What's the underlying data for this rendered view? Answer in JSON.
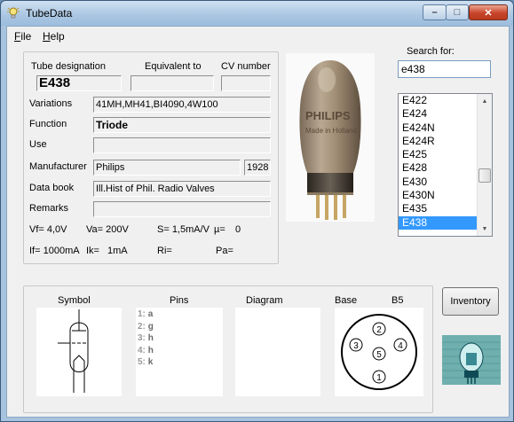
{
  "window": {
    "title": "TubeData",
    "minimize_glyph": "–",
    "maximize_glyph": "□",
    "close_glyph": "✕"
  },
  "menu": {
    "file": "File",
    "help": "Help"
  },
  "header": {
    "designation_label": "Tube designation",
    "equivalent_label": "Equivalent to",
    "cv_label": "CV number",
    "designation_value": "E438",
    "equivalent_value": "",
    "cv_value": ""
  },
  "fields": {
    "variations_label": "Variations",
    "variations_value": "41MH,MH41,BI4090,4W100",
    "function_label": "Function",
    "function_value": "Triode",
    "use_label": "Use",
    "use_value": "",
    "manufacturer_label": "Manufacturer",
    "manufacturer_value": "Philips",
    "year_value": "1928",
    "databook_label": "Data book",
    "databook_value": "Ill.Hist of Phil. Radio Valves",
    "remarks_label": "Remarks",
    "remarks_value": ""
  },
  "specs": {
    "vf": "Vf= 4,0V",
    "va": "Va= 200V",
    "s": "S= 1,5mA/V",
    "mu": "µ=",
    "mu_value": "0",
    "if": "If= 1000mA",
    "ik": "Ik=",
    "ik_value": "1mA",
    "ri": "Ri=",
    "pa": "Pa="
  },
  "search": {
    "label": "Search for:",
    "value": "e438"
  },
  "tube_list": {
    "items": [
      "E422",
      "E424",
      "E424N",
      "E424R",
      "E425",
      "E428",
      "E430",
      "E430N",
      "E435",
      "E438"
    ],
    "selected": "E438"
  },
  "bottom": {
    "symbol_label": "Symbol",
    "pins_label": "Pins",
    "diagram_label": "Diagram",
    "base_label": "Base",
    "base_value": "B5",
    "pins": [
      {
        "num": "1:",
        "val": "a"
      },
      {
        "num": "2:",
        "val": "g"
      },
      {
        "num": "3:",
        "val": "h"
      },
      {
        "num": "4:",
        "val": "h"
      },
      {
        "num": "5:",
        "val": "k"
      }
    ],
    "base_pins": [
      "1",
      "2",
      "3",
      "4",
      "5"
    ]
  },
  "buttons": {
    "inventory": "Inventory"
  },
  "photo": {
    "brand_text": "PHILIPS",
    "sub_text": "Made in Holland"
  }
}
